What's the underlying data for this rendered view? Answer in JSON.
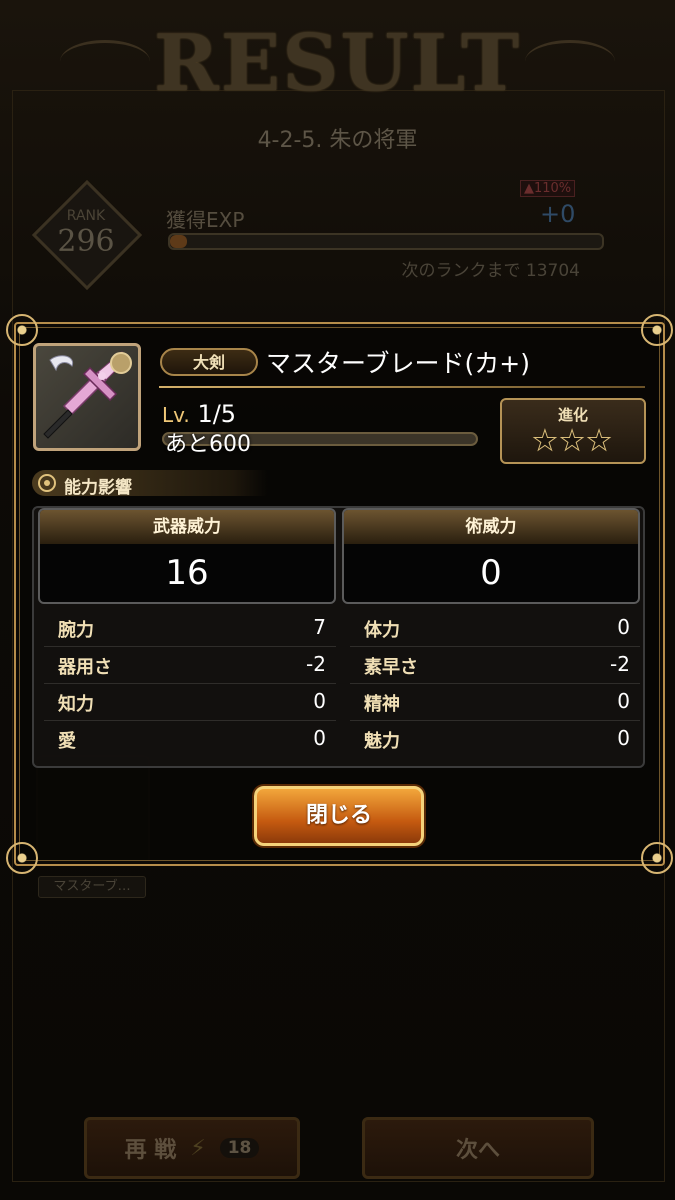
{
  "background": {
    "title": "RESULT",
    "stage": "4-2-5. 朱の将軍",
    "rank_label": "RANK",
    "rank_value": "296",
    "exp_label": "獲得EXP",
    "exp_bonus": "▲110%",
    "exp_gain": "+0",
    "exp_progress": 0.04,
    "next_rank": "次のランクまで 13704",
    "reward_name": "マスターブ…",
    "retry_label": "再 戦",
    "retry_cost": "18",
    "next_label": "次へ"
  },
  "modal": {
    "weapon_type": "大剣",
    "weapon_name": "マスターブレード(カ+)",
    "level_prefix": "Lv.",
    "level": "1/5",
    "level_progress": 0.0,
    "remaining": "あと600",
    "evolve_label": "進化",
    "evolve_stars": 3,
    "ability_header": "能力影響",
    "power": {
      "weapon_label": "武器威力",
      "weapon_value": "16",
      "magic_label": "術威力",
      "magic_value": "0"
    },
    "stats": {
      "left": [
        {
          "name": "腕力",
          "value": "7"
        },
        {
          "name": "器用さ",
          "value": "-2"
        },
        {
          "name": "知力",
          "value": "0"
        },
        {
          "name": "愛",
          "value": "0"
        }
      ],
      "right": [
        {
          "name": "体力",
          "value": "0"
        },
        {
          "name": "素早さ",
          "value": "-2"
        },
        {
          "name": "精神",
          "value": "0"
        },
        {
          "name": "魅力",
          "value": "0"
        }
      ]
    },
    "close_label": "閉じる"
  },
  "icons": {
    "weapon": "greatsword-icon",
    "enhance": "sword-emblem-icon",
    "ability": "sun-icon",
    "star": "star-icon",
    "bolt": "lightning-bolt-icon"
  },
  "colors": {
    "gold": "#d4b06a",
    "close_button": "#e07a1a",
    "background": "#0b0805"
  }
}
